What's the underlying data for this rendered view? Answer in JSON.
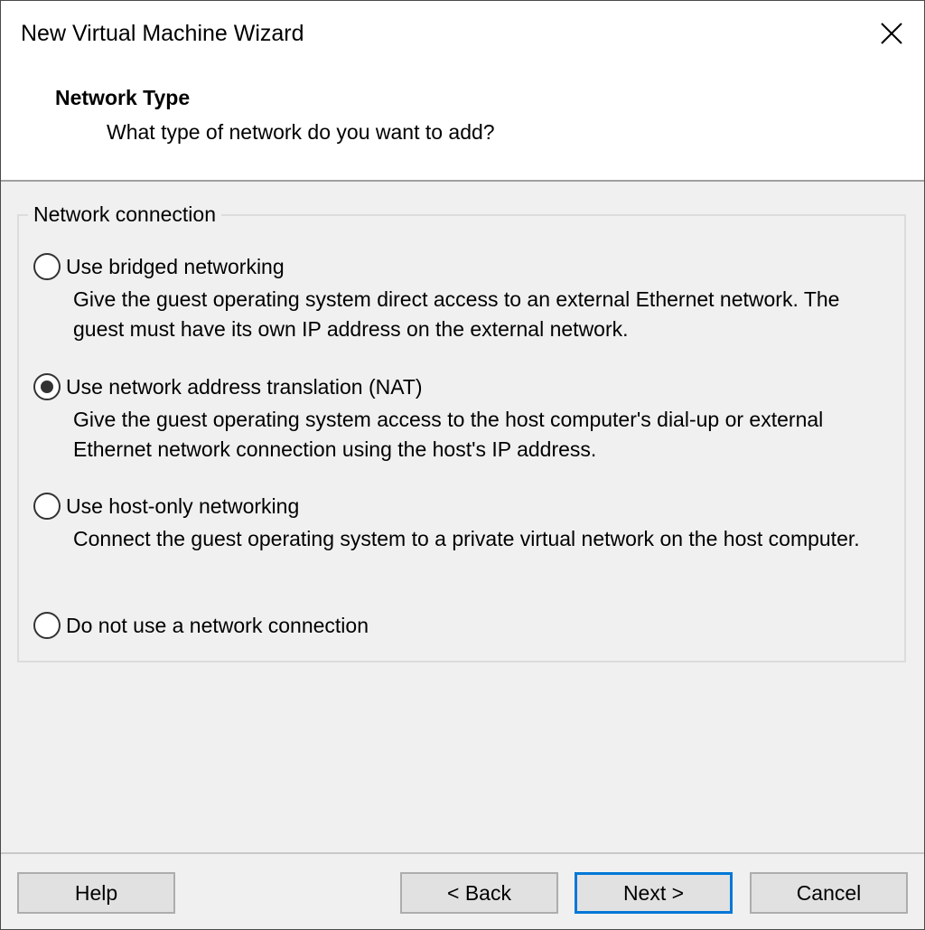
{
  "window": {
    "title": "New Virtual Machine Wizard",
    "close_icon": "close-icon"
  },
  "header": {
    "title": "Network Type",
    "subtitle": "What type of network do you want to add?"
  },
  "group": {
    "legend": "Network connection",
    "options": [
      {
        "label": "Use bridged networking",
        "description": "Give the guest operating system direct access to an external Ethernet network. The guest must have its own IP address on the external network.",
        "selected": false
      },
      {
        "label": "Use network address translation (NAT)",
        "description": "Give the guest operating system access to the host computer's dial-up or external Ethernet network connection using the host's IP address.",
        "selected": true
      },
      {
        "label": "Use host-only networking",
        "description": "Connect the guest operating system to a private virtual network on the host computer.",
        "selected": false
      },
      {
        "label": "Do not use a network connection",
        "description": "",
        "selected": false
      }
    ]
  },
  "buttons": {
    "help": "Help",
    "back": "< Back",
    "next": "Next >",
    "cancel": "Cancel"
  },
  "colors": {
    "default_button_border": "#0078d7",
    "dialog_background": "#f0f0f0",
    "header_background": "#ffffff"
  }
}
